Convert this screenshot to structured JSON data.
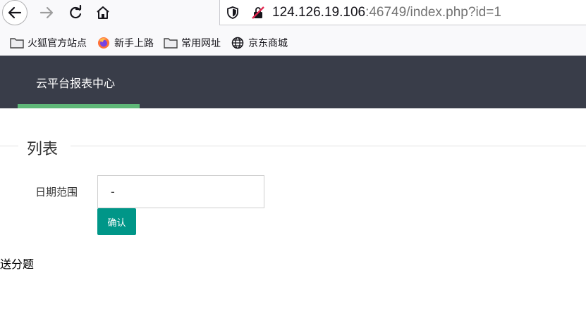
{
  "browser": {
    "url_host": "124.126.19.106",
    "url_rest": ":46749/index.php?id=1",
    "bookmarks": [
      {
        "label": "火狐官方站点",
        "icon": "folder-icon"
      },
      {
        "label": "新手上路",
        "icon": "firefox-icon"
      },
      {
        "label": "常用网址",
        "icon": "folder-icon"
      },
      {
        "label": "京东商城",
        "icon": "globe-icon"
      }
    ]
  },
  "header": {
    "title": "云平台报表中心",
    "colors": {
      "background": "#393d49",
      "underline": "#5fb878"
    }
  },
  "section": {
    "title": "列表"
  },
  "form": {
    "date_label": "日期范围",
    "date_value": "-",
    "confirm_label": "确认",
    "confirm_color": "#009688"
  },
  "footer_text": "送分题"
}
